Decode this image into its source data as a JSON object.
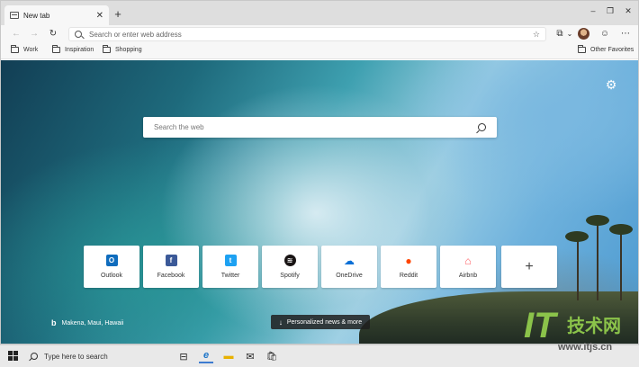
{
  "tab": {
    "title": "New tab",
    "close": "✕",
    "new_tab": "+"
  },
  "window_controls": {
    "minimize": "–",
    "maximize": "❐",
    "close": "✕"
  },
  "toolbar": {
    "back": "←",
    "forward": "→",
    "refresh": "↻",
    "address_placeholder": "Search or enter web address",
    "favorite_star": "☆",
    "collections_icon": "⧉",
    "dropdown": "⌄",
    "emoji": "☺",
    "more": "⋯"
  },
  "favorites": {
    "items": [
      {
        "label": "Work"
      },
      {
        "label": "Inspiration"
      },
      {
        "label": "Shopping"
      }
    ],
    "other": "Other Favorites"
  },
  "newtab": {
    "settings_icon": "⚙",
    "search_placeholder": "Search the web",
    "tiles": [
      {
        "label": "Outlook",
        "icon": "O",
        "color": "#0f6cbd"
      },
      {
        "label": "Facebook",
        "icon": "f",
        "color": "#3b5998"
      },
      {
        "label": "Twitter",
        "icon": "t",
        "color": "#1da1f2"
      },
      {
        "label": "Spotify",
        "icon": "≋",
        "color": "#191414"
      },
      {
        "label": "OneDrive",
        "icon": "☁",
        "color": "#0a6fd6"
      },
      {
        "label": "Reddit",
        "icon": "●",
        "color": "#ff4500"
      },
      {
        "label": "Airbnb",
        "icon": "⌂",
        "color": "#ff5a5f"
      }
    ],
    "add_tile": "+",
    "location": "Makena, Maui, Hawaii",
    "bing_mark": "b",
    "news_label": "Personalized news & more",
    "news_arrow": "↓"
  },
  "taskbar": {
    "search_placeholder": "Type here to search",
    "task_view": "⊟",
    "edge": "e",
    "explorer": "▬",
    "mail": "✉",
    "store": "🛍"
  },
  "watermark": {
    "logo": "IT",
    "brand": "技术网",
    "url": "www.itjs.cn"
  }
}
